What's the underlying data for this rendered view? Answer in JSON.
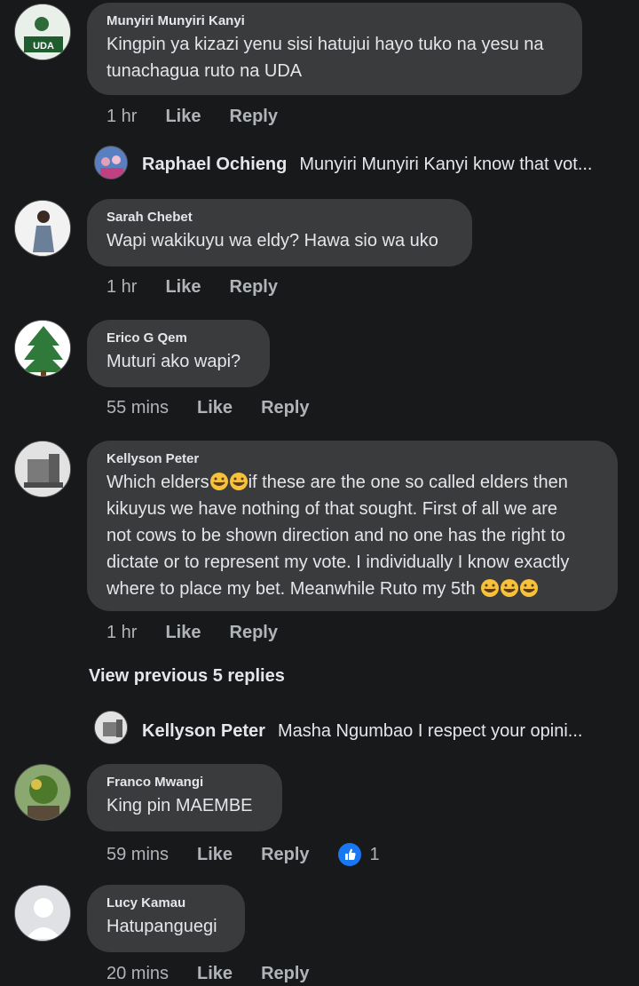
{
  "comments": [
    {
      "author": "Munyiri Munyiri Kanyi",
      "text": "Kingpin ya kizazi yenu sisi hatujui hayo tuko na yesu na tunachagua ruto na UDA",
      "time": "1 hr",
      "avatar_badge": "UDA"
    },
    {
      "author": "Sarah Chebet",
      "text": "Wapi wakikuyu wa eldy? Hawa sio wa uko",
      "time": "1 hr"
    },
    {
      "author": "Erico G Qem",
      "text": "Muturi ako wapi?",
      "time": "55 mins"
    },
    {
      "author": "Kellyson Peter",
      "text_lines": [
        "Which elders",
        "if these are the one so called elders then",
        "kikuyus we have nothing of that sought. First of all we are",
        "not cows to be shown direction and no one has the right to",
        "dictate or to represent my vote. I individually I know exactly",
        "where to place my bet. Meanwhile Ruto my 5th"
      ],
      "time": "1 hr"
    },
    {
      "author": "Franco Mwangi",
      "text": "King pin  MAEMBE",
      "time": "59 mins",
      "reaction_count": "1"
    },
    {
      "author": "Lucy Kamau",
      "text": "Hatupanguegi",
      "time": "20 mins"
    }
  ],
  "replies": [
    {
      "author": "Raphael Ochieng",
      "text": "Munyiri Munyiri Kanyi know that vot..."
    },
    {
      "author": "Kellyson Peter",
      "text": "Masha Ngumbao I respect your opini..."
    }
  ],
  "labels": {
    "like": "Like",
    "reply": "Reply",
    "view_previous": "View previous 5 replies"
  },
  "colors": {
    "background": "#18191a",
    "bubble": "#3a3b3c",
    "muted": "#b0b3b8",
    "like_blue": "#1877f2",
    "emoji_yellow": "#f7c23a"
  }
}
